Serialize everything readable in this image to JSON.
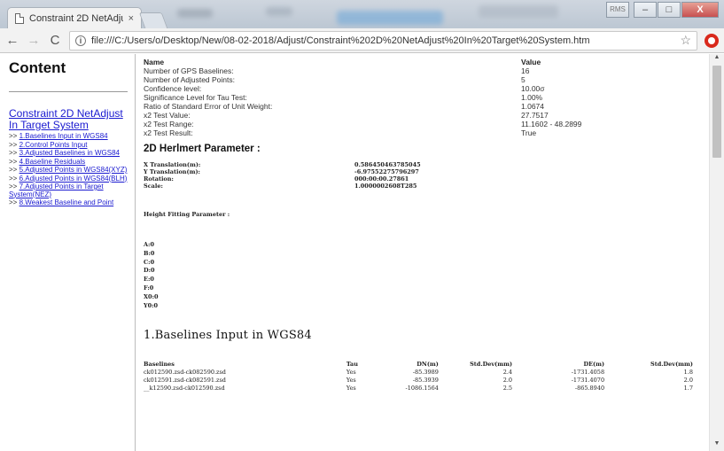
{
  "browser": {
    "tab_title": "Constraint 2D NetAdjust",
    "tab_close": "×",
    "url": "file:///C:/Users/o/Desktop/New/08-02-2018/Adjust/Constraint%202D%20NetAdjust%20In%20Target%20System.htm",
    "window_controls": {
      "user": "RMS",
      "minimize": "–",
      "maximize": "□",
      "close": "X"
    },
    "nav": {
      "back": "←",
      "forward": "→",
      "reload": "C",
      "info": "i",
      "star": "☆"
    }
  },
  "sidebar": {
    "heading": "Content",
    "main_link": "Constraint 2D NetAdjust In Target System",
    "items": [
      {
        "prefix": ">> ",
        "label": "1.Baselines Input in WGS84"
      },
      {
        "prefix": ">> ",
        "label": "2.Control Points Input"
      },
      {
        "prefix": ">> ",
        "label": "3.Adjusted Baselines in WGS84"
      },
      {
        "prefix": ">> ",
        "label": "4.Baseline Residuals"
      },
      {
        "prefix": ">> ",
        "label": "5.Adjusted Points in WGS84(XYZ)"
      },
      {
        "prefix": ">> ",
        "label": "6.Adjusted Points in WGS84(BLH)"
      },
      {
        "prefix": ">> ",
        "label": "7.Adjusted Points in Target System(NEZ)"
      },
      {
        "prefix": ">> ",
        "label": "8.Weakest Baseline and Point"
      }
    ]
  },
  "summary": {
    "header": {
      "name": "Name",
      "value": "Value"
    },
    "rows": [
      {
        "name": "Number of GPS Baselines:",
        "value": "16"
      },
      {
        "name": "Number of Adjusted Points:",
        "value": "5"
      },
      {
        "name": "Confidence level:",
        "value": "10.00σ"
      },
      {
        "name": "Significance Level for Tau Test:",
        "value": "1.00%"
      },
      {
        "name": "Ratio of Standard Error of Unit Weight:",
        "value": "1.0674"
      },
      {
        "name": "x2 Test Value:",
        "value": "27.7517"
      },
      {
        "name": "x2 Test Range:",
        "value": "11.1602 - 48.2899"
      },
      {
        "name": "x2 Test Result:",
        "value": "True"
      }
    ]
  },
  "helmert": {
    "title": "2D Herlmert Parameter :",
    "rows": [
      {
        "key": "X Translation(m):",
        "value": "0.586450463785045"
      },
      {
        "key": "Y Translation(m):",
        "value": "-6.97552275796297"
      },
      {
        "key": "Rotation:",
        "value": "000:00:00.27861"
      },
      {
        "key": "Scale:",
        "value": "1.0000002608T285"
      }
    ]
  },
  "height_fitting": {
    "title": "Height Fitting Parameter :",
    "params": [
      "A:0",
      "B:0",
      "C:0",
      "D:0",
      "E:0",
      "F:0",
      "X0:0",
      "Y0:0"
    ]
  },
  "section1": {
    "title": "1.Baselines Input in WGS84",
    "headers": [
      "Baselines",
      "Tau",
      "DN(m)",
      "Std.Dev(mm)",
      "DE(m)",
      "Std.Dev(mm)"
    ],
    "rows": [
      [
        "ck012590.zsd-ck082590.zsd",
        "Yes",
        "-85.3989",
        "2.4",
        "-1731.4058",
        "1.8"
      ],
      [
        "ck012591.zsd-ck082591.zsd",
        "Yes",
        "-85.3939",
        "2.0",
        "-1731.4070",
        "2.0"
      ],
      [
        "__k12590.zsd-ck012590.zsd",
        "Yes",
        "-1086.1564",
        "2.5",
        "-865.8940",
        "1.7"
      ]
    ]
  },
  "scrollbar": {
    "up": "▲",
    "down": "▼"
  }
}
